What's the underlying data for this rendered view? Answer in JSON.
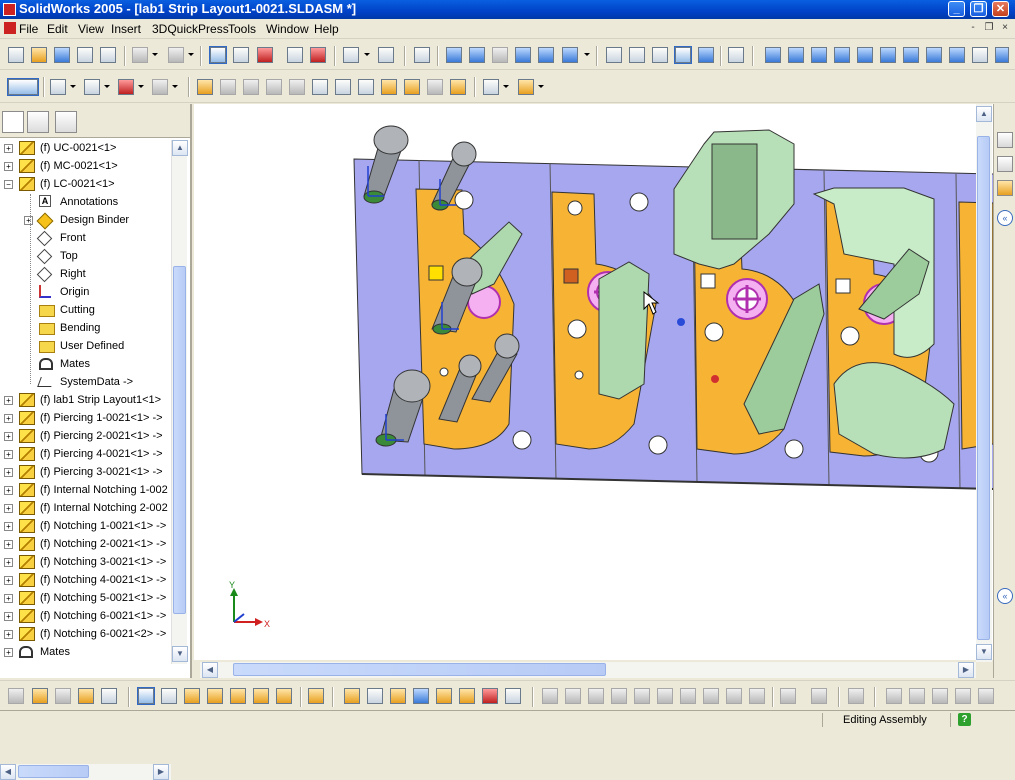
{
  "window": {
    "title": "SolidWorks 2005 - [lab1 Strip Layout1-0021.SLDASM *]",
    "minimize": "_",
    "maximize": "❐",
    "close": "✕"
  },
  "menu": [
    "File",
    "Edit",
    "View",
    "Insert",
    "3DQuickPress",
    "Tools",
    "Window",
    "Help"
  ],
  "mdi_buttons": [
    "-",
    "❐",
    "×"
  ],
  "tree": {
    "items": [
      {
        "label": "(f) UC-0021<1>",
        "icon": "component-icon",
        "expander": "+"
      },
      {
        "label": "(f) MC-0021<1>",
        "icon": "component-icon",
        "expander": "+"
      },
      {
        "label": "(f) LC-0021<1>",
        "icon": "component-icon",
        "expander": "−"
      },
      {
        "label": "Annotations",
        "icon": "annotations-icon",
        "expander": ""
      },
      {
        "label": "Design Binder",
        "icon": "design-binder-icon",
        "expander": "+"
      },
      {
        "label": "Front",
        "icon": "plane-icon",
        "expander": ""
      },
      {
        "label": "Top",
        "icon": "plane-icon",
        "expander": ""
      },
      {
        "label": "Right",
        "icon": "plane-icon",
        "expander": ""
      },
      {
        "label": "Origin",
        "icon": "origin-icon",
        "expander": ""
      },
      {
        "label": "Cutting",
        "icon": "folder-icon",
        "expander": ""
      },
      {
        "label": "Bending",
        "icon": "folder-icon",
        "expander": ""
      },
      {
        "label": "User Defined",
        "icon": "folder-icon",
        "expander": ""
      },
      {
        "label": "Mates",
        "icon": "mates-icon",
        "expander": ""
      },
      {
        "label": "SystemData ->",
        "icon": "system-data-icon",
        "expander": ""
      },
      {
        "label": "(f) lab1 Strip Layout1<1>",
        "icon": "component-icon",
        "expander": "+"
      },
      {
        "label": "(f) Piercing 1-0021<1> ->",
        "icon": "component-icon",
        "expander": "+"
      },
      {
        "label": "(f) Piercing 2-0021<1> ->",
        "icon": "component-icon",
        "expander": "+"
      },
      {
        "label": "(f) Piercing 4-0021<1> ->",
        "icon": "component-icon",
        "expander": "+"
      },
      {
        "label": "(f) Piercing 3-0021<1> ->",
        "icon": "component-icon",
        "expander": "+"
      },
      {
        "label": "(f) Internal Notching 1-002",
        "icon": "component-icon",
        "expander": "+"
      },
      {
        "label": "(f) Internal Notching 2-002",
        "icon": "component-icon",
        "expander": "+"
      },
      {
        "label": "(f) Notching 1-0021<1> ->",
        "icon": "component-icon",
        "expander": "+"
      },
      {
        "label": "(f) Notching 2-0021<1> ->",
        "icon": "component-icon",
        "expander": "+"
      },
      {
        "label": "(f) Notching 3-0021<1> ->",
        "icon": "component-icon",
        "expander": "+"
      },
      {
        "label": "(f) Notching 4-0021<1> ->",
        "icon": "component-icon",
        "expander": "+"
      },
      {
        "label": "(f) Notching 5-0021<1> ->",
        "icon": "component-icon",
        "expander": "+"
      },
      {
        "label": "(f) Notching 6-0021<1> ->",
        "icon": "component-icon",
        "expander": "+"
      },
      {
        "label": "(f) Notching 6-0021<2> ->",
        "icon": "component-icon",
        "expander": "+"
      },
      {
        "label": "Mates",
        "icon": "mates-icon",
        "expander": "+"
      }
    ]
  },
  "triad": {
    "x_label": "X",
    "y_label": "Y"
  },
  "status": {
    "text": "Editing Assembly",
    "help": "?"
  },
  "colors": {
    "die_plate": "#a7a7ef",
    "strip": "#f7b334",
    "punch": "#9aa0a6",
    "notch_tool": "#b8e0b8",
    "pink_feature": "#e070e0",
    "title_bar": "#0a5fe0"
  }
}
